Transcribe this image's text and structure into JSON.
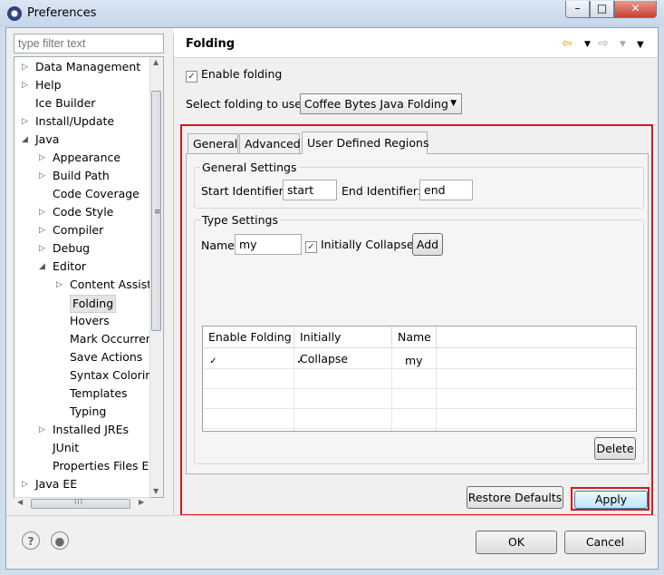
{
  "window": {
    "title": "Preferences",
    "minimize": "–",
    "maximize": "□",
    "close": "✕"
  },
  "filter": {
    "placeholder": "type filter text"
  },
  "tree": {
    "items": [
      {
        "label": "Data Management",
        "level": 0,
        "arrow": "right"
      },
      {
        "label": "Help",
        "level": 0,
        "arrow": "right"
      },
      {
        "label": "Ice Builder",
        "level": 0,
        "arrow": "none"
      },
      {
        "label": "Install/Update",
        "level": 0,
        "arrow": "right"
      },
      {
        "label": "Java",
        "level": 0,
        "arrow": "down"
      },
      {
        "label": "Appearance",
        "level": 1,
        "arrow": "right"
      },
      {
        "label": "Build Path",
        "level": 1,
        "arrow": "right"
      },
      {
        "label": "Code Coverage",
        "level": 1,
        "arrow": "none"
      },
      {
        "label": "Code Style",
        "level": 1,
        "arrow": "right"
      },
      {
        "label": "Compiler",
        "level": 1,
        "arrow": "right"
      },
      {
        "label": "Debug",
        "level": 1,
        "arrow": "right"
      },
      {
        "label": "Editor",
        "level": 1,
        "arrow": "down"
      },
      {
        "label": "Content Assist",
        "level": 2,
        "arrow": "right"
      },
      {
        "label": "Folding",
        "level": 2,
        "arrow": "none",
        "selected": true
      },
      {
        "label": "Hovers",
        "level": 2,
        "arrow": "none"
      },
      {
        "label": "Mark Occurren",
        "level": 2,
        "arrow": "none"
      },
      {
        "label": "Save Actions",
        "level": 2,
        "arrow": "none"
      },
      {
        "label": "Syntax Coloring",
        "level": 2,
        "arrow": "none"
      },
      {
        "label": "Templates",
        "level": 2,
        "arrow": "none"
      },
      {
        "label": "Typing",
        "level": 2,
        "arrow": "none"
      },
      {
        "label": "Installed JREs",
        "level": 1,
        "arrow": "right"
      },
      {
        "label": "JUnit",
        "level": 1,
        "arrow": "none"
      },
      {
        "label": "Properties Files Ed",
        "level": 1,
        "arrow": "none"
      },
      {
        "label": "Java EE",
        "level": 0,
        "arrow": "right"
      }
    ]
  },
  "page": {
    "title": "Folding",
    "enable_folding": {
      "label": "Enable folding",
      "checked": true
    },
    "select_label": "Select folding to use:",
    "select_value": "Coffee Bytes Java Folding",
    "tabs": [
      {
        "label": "General"
      },
      {
        "label": "Advanced"
      },
      {
        "label": "User Defined Regions",
        "active": true
      }
    ],
    "general_settings": {
      "legend": "General Settings",
      "start_label": "Start Identifier:",
      "start_value": "start",
      "end_label": "End Identifier:",
      "end_value": "end"
    },
    "type_settings": {
      "legend": "Type Settings",
      "name_label": "Name",
      "name_value": "my",
      "collapse_label": "Initially Collapse",
      "collapse_checked": true,
      "add_label": "Add"
    },
    "table": {
      "columns": [
        "Enable Folding",
        "Initially Collapse",
        "Name"
      ],
      "rows": [
        {
          "enable": "✓",
          "collapse": "✓",
          "name": "my"
        }
      ]
    },
    "delete_label": "Delete",
    "restore_label": "Restore Defaults",
    "apply_label": "Apply"
  },
  "footer": {
    "ok_label": "OK",
    "cancel_label": "Cancel"
  },
  "colors": {
    "highlight": "#d8161f",
    "accent": "#3b4a8c"
  }
}
